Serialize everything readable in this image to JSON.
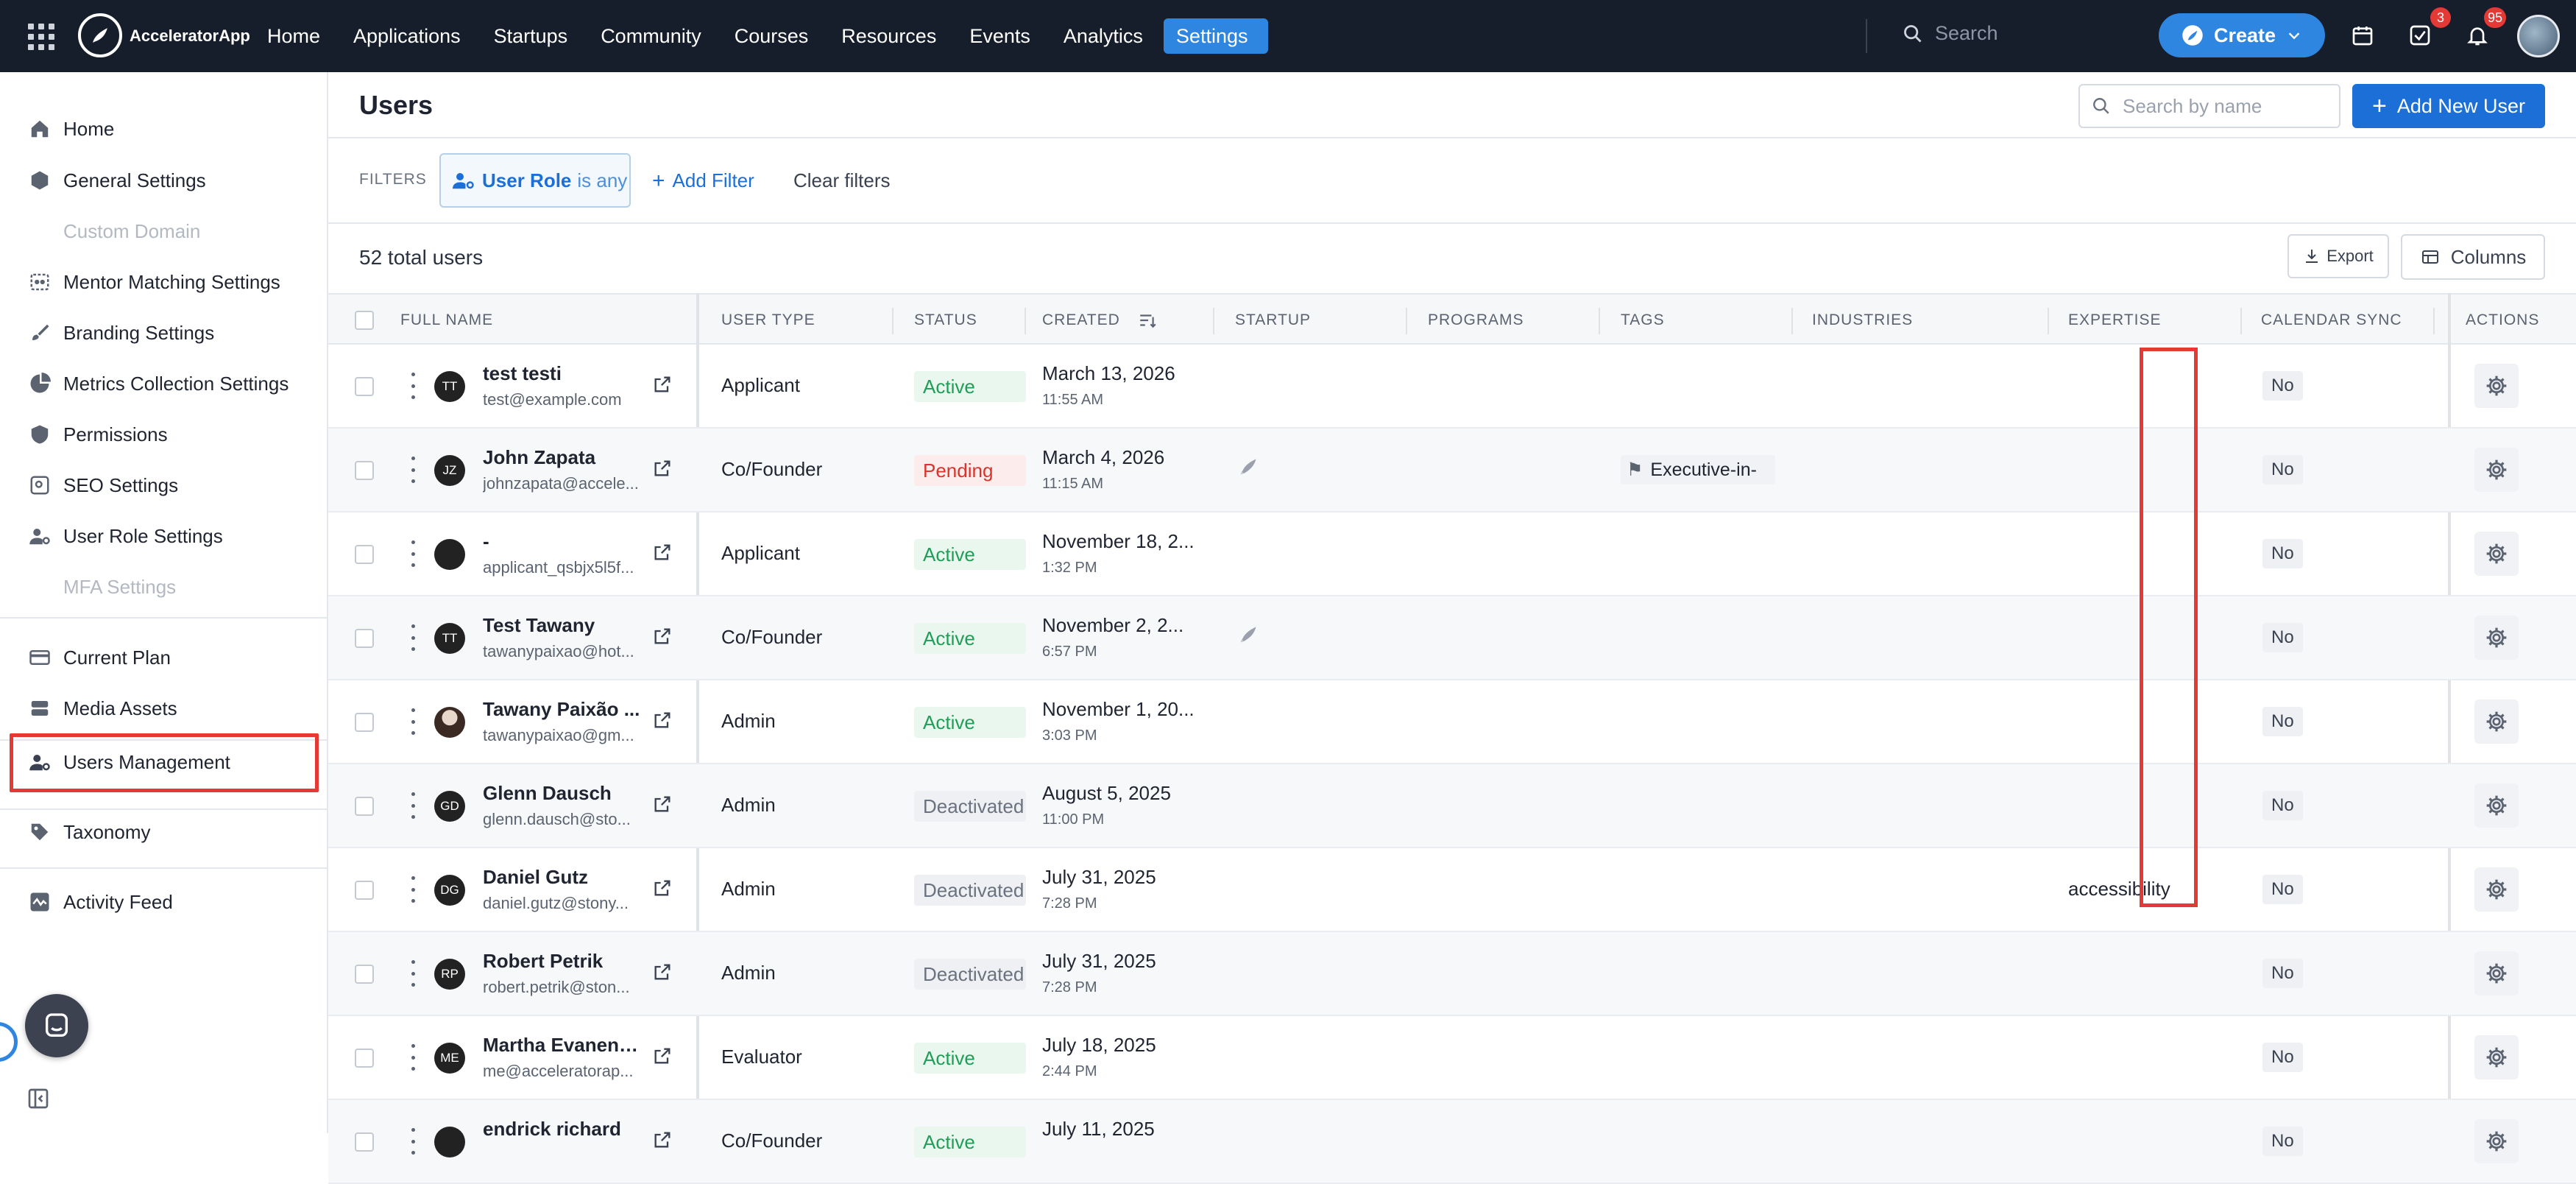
{
  "topnav": {
    "brand": "AcceleratorApp",
    "links": [
      "Home",
      "Applications",
      "Startups",
      "Community",
      "Courses",
      "Resources",
      "Events",
      "Analytics",
      "Settings"
    ],
    "active_link": "Settings",
    "search_placeholder": "Search",
    "create_label": "Create",
    "tasks_badge": "3",
    "notifications_badge": "95"
  },
  "sidebar": {
    "items": [
      {
        "label": "Home",
        "icon": "home-icon",
        "disabled": false
      },
      {
        "label": "General Settings",
        "icon": "cube-icon",
        "disabled": false
      },
      {
        "label": "Custom Domain",
        "icon": "globe-icon",
        "disabled": true
      },
      {
        "label": "Mentor Matching Settings",
        "icon": "match-icon",
        "disabled": false
      },
      {
        "label": "Branding Settings",
        "icon": "brush-icon",
        "disabled": false
      },
      {
        "label": "Metrics Collection Settings",
        "icon": "chart-icon",
        "disabled": false
      },
      {
        "label": "Permissions",
        "icon": "shield-icon",
        "disabled": false
      },
      {
        "label": "SEO Settings",
        "icon": "seo-icon",
        "disabled": false
      },
      {
        "label": "User Role Settings",
        "icon": "user-gear-icon",
        "disabled": false
      },
      {
        "label": "MFA Settings",
        "icon": "lock-icon",
        "disabled": true
      },
      {
        "label": "Current Plan",
        "icon": "card-icon",
        "disabled": false
      },
      {
        "label": "Media Assets",
        "icon": "stack-icon",
        "disabled": false
      },
      {
        "label": "Users Management",
        "icon": "users-gear-icon",
        "disabled": false
      },
      {
        "label": "Taxonomy",
        "icon": "tag-icon",
        "disabled": false
      },
      {
        "label": "Activity Feed",
        "icon": "activity-icon",
        "disabled": false
      }
    ],
    "selected": "Users Management"
  },
  "page": {
    "title": "Users",
    "search_placeholder": "Search by name",
    "add_button": "Add New User",
    "filters_label": "FILTERS",
    "filter_chip": {
      "field": "User Role",
      "op": "is any"
    },
    "add_filter": "Add Filter",
    "clear_filters": "Clear filters",
    "total": "52 total users",
    "export": "Export",
    "columns": "Columns"
  },
  "table": {
    "headers": [
      "FULL NAME",
      "USER TYPE",
      "STATUS",
      "CREATED",
      "STARTUP",
      "PROGRAMS",
      "TAGS",
      "INDUSTRIES",
      "EXPERTISE",
      "CALENDAR SYNC",
      "ACTIONS"
    ],
    "rows": [
      {
        "initials": "TT",
        "name": "test testi",
        "email": "test@example.com",
        "type": "Applicant",
        "status": "Active",
        "date": "March 13, 2026",
        "time": "11:55 AM",
        "startup": false,
        "tag": "",
        "expertise": "",
        "calendar": "No"
      },
      {
        "initials": "JZ",
        "name": "John Zapata",
        "email": "johnzapata@accele...",
        "type": "Co/Founder",
        "status": "Pending",
        "date": "March 4, 2026",
        "time": "11:15 AM",
        "startup": true,
        "tag": "Executive-in-",
        "expertise": "",
        "calendar": "No"
      },
      {
        "initials": "",
        "name": "-",
        "email": "applicant_qsbjx5l5f...",
        "type": "Applicant",
        "status": "Active",
        "date": "November 18, 2...",
        "time": "1:32 PM",
        "startup": false,
        "tag": "",
        "expertise": "",
        "calendar": "No"
      },
      {
        "initials": "TT",
        "name": "Test Tawany",
        "email": "tawanypaixao@hot...",
        "type": "Co/Founder",
        "status": "Active",
        "date": "November 2, 2...",
        "time": "6:57 PM",
        "startup": true,
        "tag": "",
        "expertise": "",
        "calendar": "No"
      },
      {
        "initials": "",
        "name": "Tawany Paixão ...",
        "email": "tawanypaixao@gm...",
        "type": "Admin",
        "status": "Active",
        "date": "November 1, 20...",
        "time": "3:03 PM",
        "startup": false,
        "tag": "",
        "expertise": "",
        "calendar": "No",
        "photo": true
      },
      {
        "initials": "GD",
        "name": "Glenn Dausch",
        "email": "glenn.dausch@sto...",
        "type": "Admin",
        "status": "Deactivated",
        "date": "August 5, 2025",
        "time": "11:00 PM",
        "startup": false,
        "tag": "",
        "expertise": "",
        "calendar": "No"
      },
      {
        "initials": "DG",
        "name": "Daniel Gutz",
        "email": "daniel.gutz@stony...",
        "type": "Admin",
        "status": "Deactivated",
        "date": "July 31, 2025",
        "time": "7:28 PM",
        "startup": false,
        "tag": "",
        "expertise": "accessibility",
        "calendar": "No"
      },
      {
        "initials": "RP",
        "name": "Robert Petrik",
        "email": "robert.petrik@ston...",
        "type": "Admin",
        "status": "Deactivated",
        "date": "July 31, 2025",
        "time": "7:28 PM",
        "startup": false,
        "tag": "",
        "expertise": "",
        "calendar": "No"
      },
      {
        "initials": "ME",
        "name": "Martha Evanens...",
        "email": "me@acceleratorap...",
        "type": "Evaluator",
        "status": "Active",
        "date": "July 18, 2025",
        "time": "2:44 PM",
        "startup": false,
        "tag": "",
        "expertise": "",
        "calendar": "No"
      },
      {
        "initials": "",
        "name": "endrick richard",
        "email": "",
        "type": "Co/Founder",
        "status": "Active",
        "date": "July 11, 2025",
        "time": "",
        "startup": false,
        "tag": "",
        "expertise": "",
        "calendar": "No"
      }
    ]
  },
  "colors": {
    "nav_bg": "#161d2b",
    "accent": "#2f86e0",
    "highlight": "#e53935"
  }
}
